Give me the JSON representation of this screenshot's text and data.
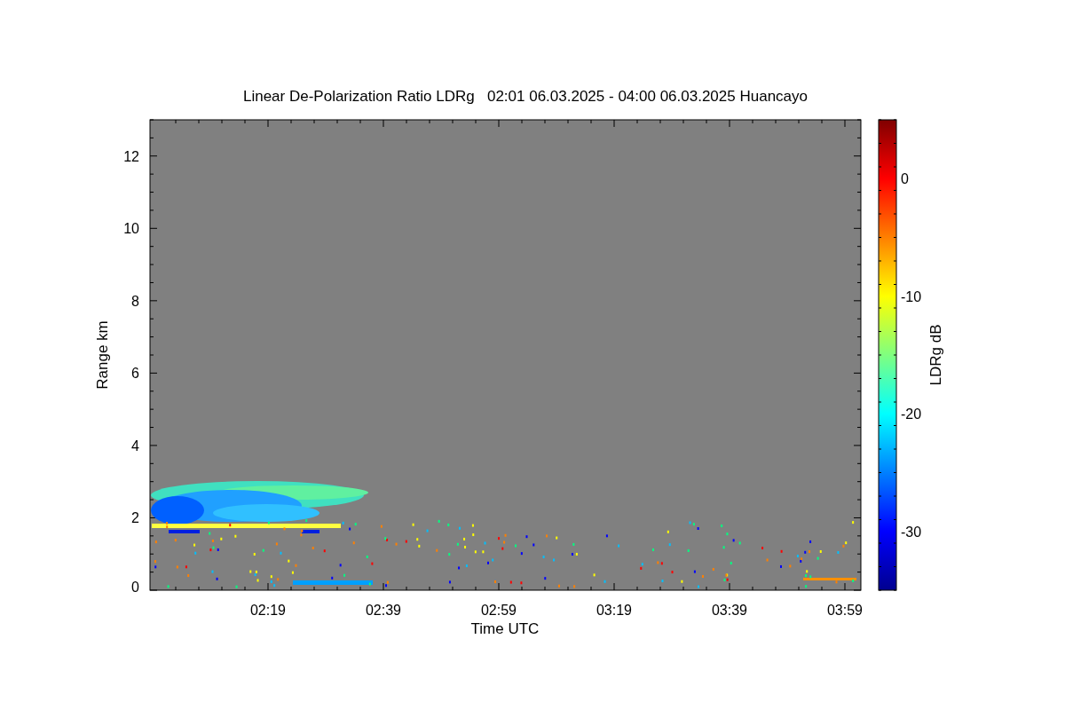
{
  "plot": {
    "title": "Linear De-Polarization Ratio LDRg   02:01 06.03.2025 - 04:00 06.03.2025 Huancayo",
    "ylabel": "Range km",
    "xlabel": "Time UTC",
    "yticks": [
      "12",
      "10",
      "8",
      "6",
      "4",
      "2",
      "0"
    ],
    "xticks": [
      "02:19",
      "02:39",
      "02:59",
      "03:19",
      "03:39",
      "03:59"
    ],
    "colorbar": {
      "label": "LDRg dB",
      "ticks": [
        "0",
        "-10",
        "-20",
        "-30"
      ]
    }
  }
}
